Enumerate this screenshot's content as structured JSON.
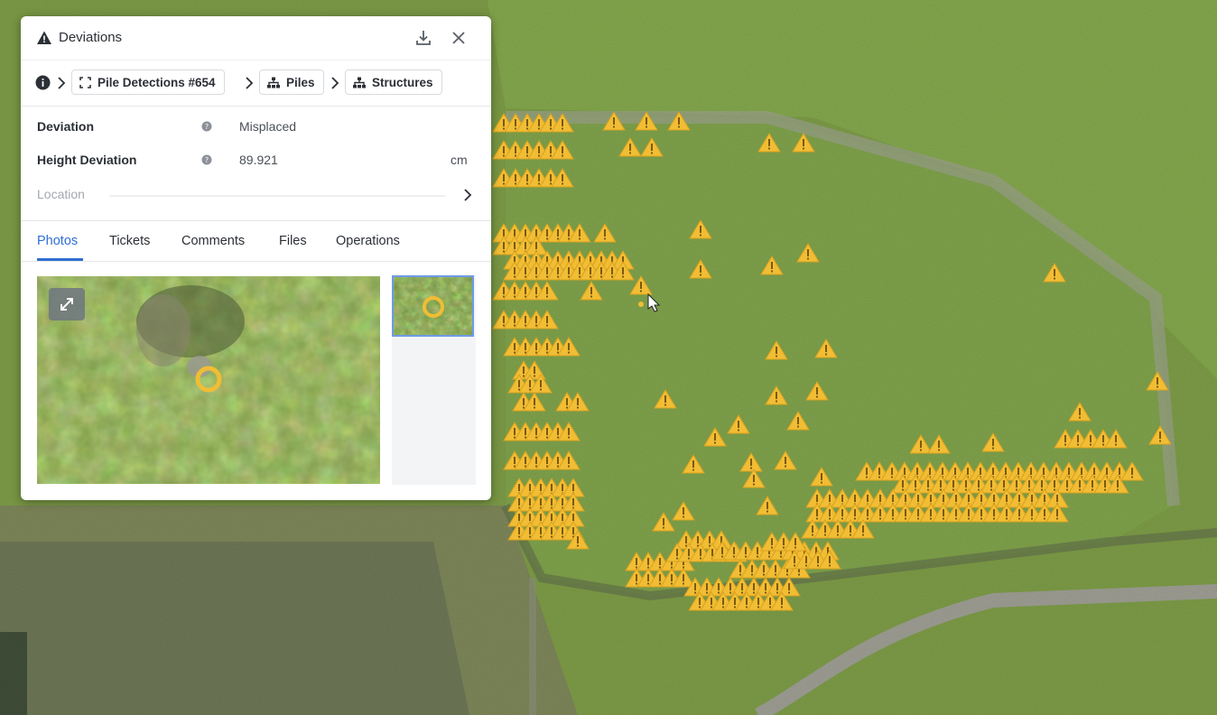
{
  "panel": {
    "title": "Deviations",
    "title_icon": "warning-triangle-icon",
    "breadcrumb": [
      {
        "label": "Pile Detections #654",
        "icon": "bounding-box-icon"
      },
      {
        "label": "Piles",
        "icon": "hierarchy-icon"
      },
      {
        "label": "Structures",
        "icon": "hierarchy-icon"
      }
    ],
    "properties": [
      {
        "label": "Deviation",
        "value": "Misplaced",
        "unit": ""
      },
      {
        "label": "Height Deviation",
        "value": "89.921",
        "unit": "cm"
      }
    ],
    "location_label": "Location",
    "tabs": [
      "Photos",
      "Tickets",
      "Comments",
      "Files",
      "Operations"
    ],
    "active_tab": "Photos"
  },
  "colors": {
    "marker": "#f1bd34",
    "accent": "#2f6fd1",
    "thumb_border": "#6e9be6"
  }
}
